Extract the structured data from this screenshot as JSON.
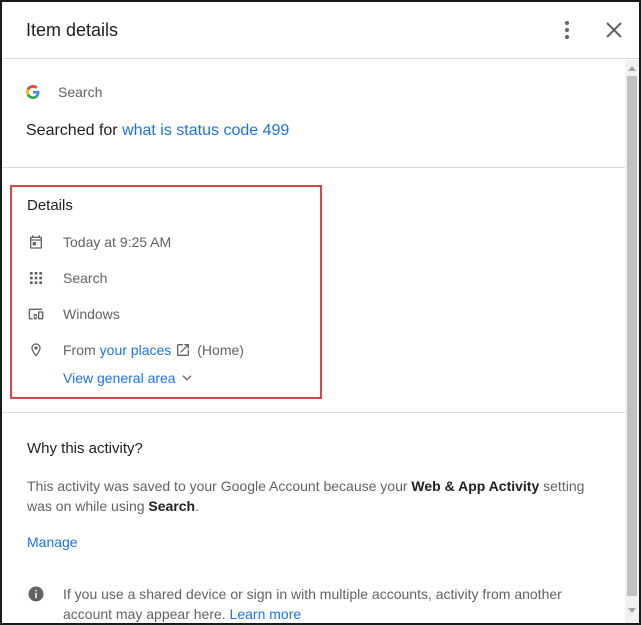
{
  "header": {
    "title": "Item details",
    "more_icon": "more-vert-icon",
    "close_icon": "close-icon"
  },
  "product": {
    "name": "Search",
    "icon": "google-g-logo"
  },
  "activity": {
    "prefix": "Searched for",
    "query": "what is status code 499"
  },
  "details": {
    "heading": "Details",
    "time": "Today at 9:25 AM",
    "product": "Search",
    "device": "Windows",
    "location_prefix": "From",
    "location_link": "your places",
    "location_suffix": "(Home)",
    "view_area": "View general area"
  },
  "why": {
    "heading": "Why this activity?",
    "text_1": "This activity was saved to your Google Account because your ",
    "bold_1": "Web & App Activity",
    "text_2": " setting was on while using ",
    "bold_2": "Search",
    "text_3": ".",
    "manage": "Manage"
  },
  "info": {
    "text": "If you use a shared device or sign in with multiple accounts, activity from another account may appear here. ",
    "learn_more": "Learn more"
  },
  "colors": {
    "link": "#1a73e8",
    "highlight_border": "#e04444",
    "text_secondary": "#5f6368"
  }
}
